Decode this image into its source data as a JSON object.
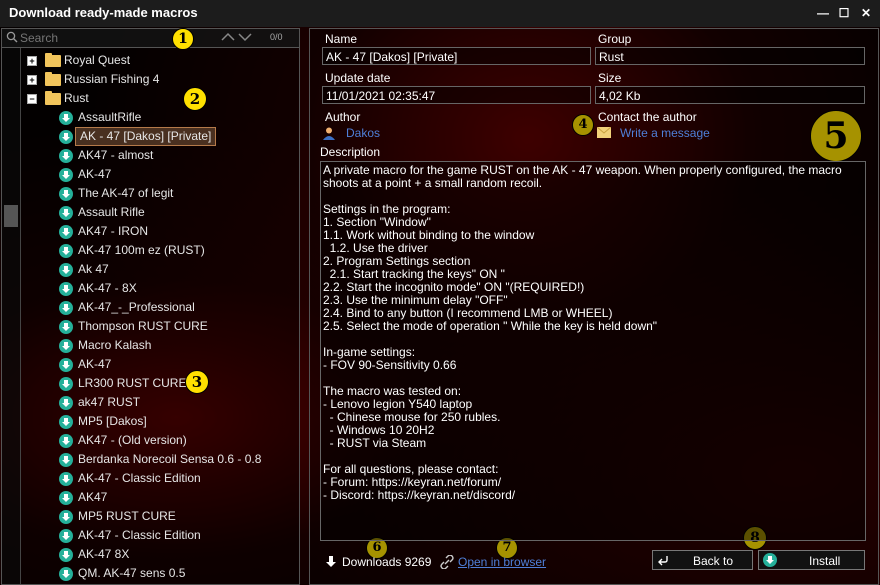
{
  "window": {
    "title": "Download ready-made macros",
    "min": "—",
    "max": "☐",
    "close": "✕"
  },
  "search": {
    "placeholder": "Search",
    "count": "0/0"
  },
  "tree": {
    "folders": [
      {
        "name": "Royal Quest",
        "expanded": false
      },
      {
        "name": "Russian Fishing 4",
        "expanded": false
      },
      {
        "name": "Rust",
        "expanded": true
      }
    ],
    "items": [
      "AssaultRifle",
      "AK - 47 [Dakos] [Private]",
      "AK47 - almost",
      "AK-47",
      "The AK-47 of legit",
      "Assault Rifle",
      "AK47 - IRON",
      "AK-47 100m ez (RUST)",
      "Ak 47",
      "AK-47 - 8X",
      "AK-47_-_Professional",
      "Thompson RUST CURE",
      "Macro Kalash",
      "AK-47",
      "LR300 RUST CURE",
      "ak47 RUST",
      "MP5 [Dakos]",
      "AK47 - (Old version)",
      "Berdanka Norecoil Sensa 0.6 - 0.8",
      "AK-47 - Classic Edition",
      "AK47",
      "MP5 RUST CURE",
      "AK-47 - Classic Edition",
      "AK-47 8X",
      "QM. AK-47 sens 0.5"
    ],
    "selected_index": 1
  },
  "detail": {
    "name_label": "Name",
    "name_value": "AK - 47 [Dakos] [Private]",
    "group_label": "Group",
    "group_value": "Rust",
    "update_label": "Update date",
    "update_value": "11/01/2021 02:35:47",
    "size_label": "Size",
    "size_value": "4,02 Kb",
    "author_label": "Author",
    "author_value": "Dakos",
    "contact_label": "Contact the author",
    "contact_value": "Write a message",
    "description_label": "Description",
    "description": "A private macro for the game RUST on the AK - 47 weapon. When properly configured, the macro shoots at a point + a small random recoil.\n\nSettings in the program:\n1. Section \"Window\"\n1.1. Work without binding to the window\n  1.2. Use the driver\n2. Program Settings section\n  2.1. Start tracking the keys\" ON \"\n2.2. Start the incognito mode\" ON \"(REQUIRED!)\n2.3. Use the minimum delay \"OFF\"\n2.4. Bind to any button (I recommend LMB or WHEEL)\n2.5. Select the mode of operation \" While the key is held down\"\n\nIn-game settings:\n- FOV 90-Sensitivity 0.66\n\nThe macro was tested on:\n- Lenovo legion Y540 laptop\n  - Chinese mouse for 250 rubles.\n  - Windows 10 20H2\n  - RUST via Steam\n\nFor all questions, please contact:\n- Forum: https://keyran.net/forum/\n- Discord: https://keyran.net/discord/"
  },
  "footer": {
    "downloads": "Downloads 9269",
    "open_browser": "Open in browser",
    "back": "Back to",
    "install": "Install"
  },
  "badges": [
    "1",
    "2",
    "3",
    "4",
    "5",
    "6",
    "7",
    "8"
  ],
  "colors": {
    "accent_teal": "#25b09a",
    "badge_yellow": "#ffe000",
    "link_blue": "#4f7fd8",
    "folder": "#f2c55c"
  }
}
